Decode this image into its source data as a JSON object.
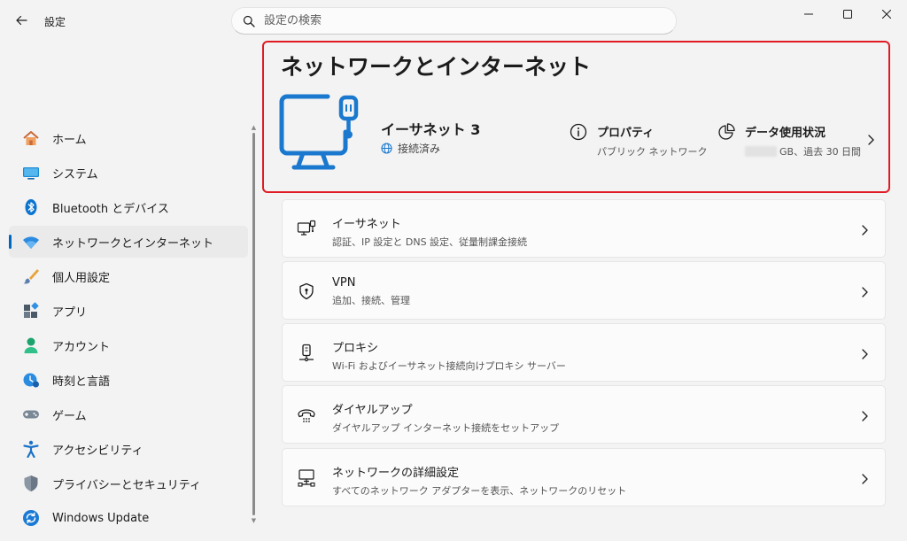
{
  "app": {
    "title": "設定",
    "search_placeholder": "設定の検索"
  },
  "sidebar": {
    "items": [
      {
        "label": "ホーム",
        "icon": "home-icon"
      },
      {
        "label": "システム",
        "icon": "system-icon"
      },
      {
        "label": "Bluetooth とデバイス",
        "icon": "bluetooth-icon"
      },
      {
        "label": "ネットワークとインターネット",
        "icon": "wifi-icon",
        "active": true
      },
      {
        "label": "個人用設定",
        "icon": "brush-icon"
      },
      {
        "label": "アプリ",
        "icon": "apps-icon"
      },
      {
        "label": "アカウント",
        "icon": "account-icon"
      },
      {
        "label": "時刻と言語",
        "icon": "time-language-icon"
      },
      {
        "label": "ゲーム",
        "icon": "gamepad-icon"
      },
      {
        "label": "アクセシビリティ",
        "icon": "accessibility-icon"
      },
      {
        "label": "プライバシーとセキュリティ",
        "icon": "shield-icon"
      },
      {
        "label": "Windows Update",
        "icon": "windows-update-icon"
      }
    ]
  },
  "main": {
    "page_title": "ネットワークとインターネット",
    "hero": {
      "name": "イーサネット 3",
      "status": "接続済み",
      "properties_title": "プロパティ",
      "properties_sub": "パブリック ネットワーク",
      "data_title": "データ使用状況",
      "data_sub": "GB、過去 30 日間"
    },
    "cards": [
      {
        "title": "イーサネット",
        "desc": "認証、IP 設定と DNS 設定、従量制課金接続",
        "icon": "ethernet-icon"
      },
      {
        "title": "VPN",
        "desc": "追加、接続、管理",
        "icon": "vpn-shield-icon"
      },
      {
        "title": "プロキシ",
        "desc": "Wi-Fi およびイーサネット接続向けプロキシ サーバー",
        "icon": "proxy-icon"
      },
      {
        "title": "ダイヤルアップ",
        "desc": "ダイヤルアップ インターネット接続をセットアップ",
        "icon": "dialup-icon"
      },
      {
        "title": "ネットワークの詳細設定",
        "desc": "すべてのネットワーク アダプターを表示、ネットワークのリセット",
        "icon": "network-advanced-icon"
      }
    ]
  },
  "colors": {
    "accent": "#0067c0",
    "highlight_border": "#e01b24"
  }
}
